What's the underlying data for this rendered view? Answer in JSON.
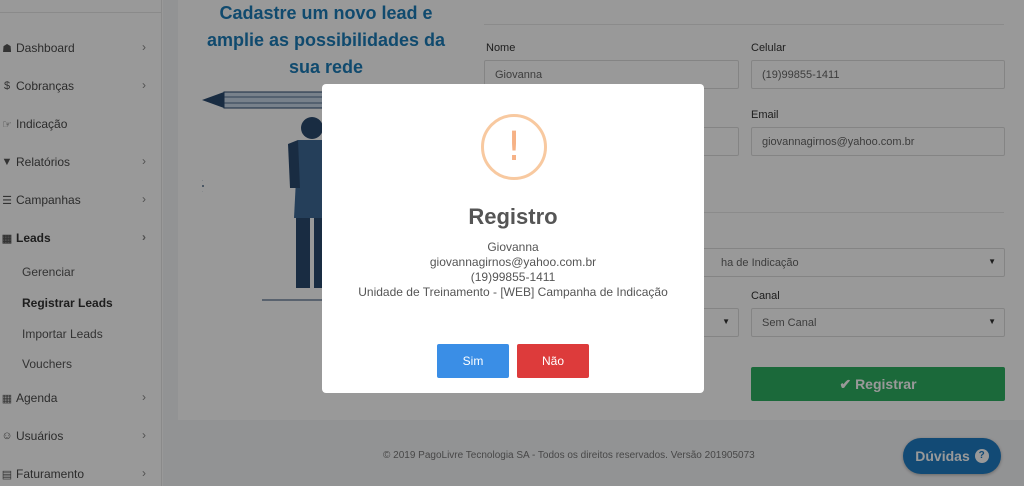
{
  "sidebar": {
    "items": [
      {
        "label": "Dashboard",
        "icon": "dashboard-icon",
        "glyph": "☗",
        "chevron": "›"
      },
      {
        "label": "Cobranças",
        "icon": "dollar-icon",
        "glyph": "$",
        "chevron": "›"
      },
      {
        "label": "Indicação",
        "icon": "handshake-icon",
        "glyph": "☞",
        "chevron": ""
      },
      {
        "label": "Relatórios",
        "icon": "filter-icon",
        "glyph": "▼",
        "chevron": "›"
      },
      {
        "label": "Campanhas",
        "icon": "list-icon",
        "glyph": "☰",
        "chevron": "›"
      },
      {
        "label": "Leads",
        "icon": "calendar-icon",
        "glyph": "▦",
        "chevron": "›"
      },
      {
        "label": "Agenda",
        "icon": "calendar-icon",
        "glyph": "▦",
        "chevron": "›"
      },
      {
        "label": "Usuários",
        "icon": "users-icon",
        "glyph": "☺",
        "chevron": "›"
      },
      {
        "label": "Faturamento",
        "icon": "document-icon",
        "glyph": "▤",
        "chevron": "›"
      }
    ],
    "sub_items": [
      "Gerenciar",
      "Registrar Leads",
      "Importar Leads",
      "Vouchers"
    ]
  },
  "promo": {
    "title": "Cadastre um novo lead e amplie as possibilidades da sua rede"
  },
  "form": {
    "nome_label": "Nome",
    "nome_value": "Giovanna",
    "celular_label": "Celular",
    "celular_value": "(19)99855-1411",
    "email_label": "Email",
    "email_value": "giovannagirnos@yahoo.com.br",
    "campanha_value": "ha de Indicação",
    "canal_label": "Canal",
    "canal_value": "Sem Canal",
    "register_label": "✔ Registrar"
  },
  "footer": {
    "text": "© 2019 PagoLivre Tecnologia SA - Todos os direitos reservados. Versão 201905073",
    "help_label": "Dúvidas",
    "help_icon": "?"
  },
  "modal": {
    "icon": "!",
    "title": "Registro",
    "lines": [
      "Giovanna",
      "giovannagirnos@yahoo.com.br",
      "(19)99855-1411",
      "Unidade de Treinamento - [WEB] Campanha de Indicação"
    ],
    "yes_label": "Sim",
    "no_label": "Não"
  },
  "colors": {
    "accent_blue": "#1c7cb8",
    "success_green": "#2eaf62",
    "danger_red": "#dd3b3b",
    "primary_blue": "#3a8ee6",
    "warning_orange": "#f8c9a0"
  }
}
